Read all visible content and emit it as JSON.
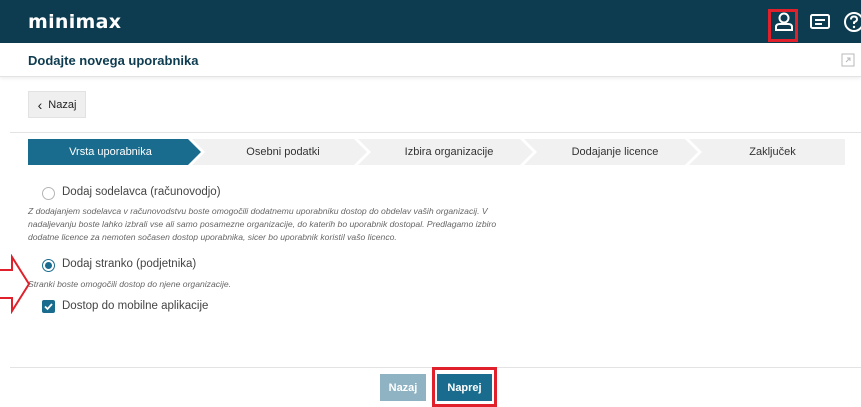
{
  "app": {
    "logo": "minimax"
  },
  "header": {
    "title": "Dodajte novega uporabnika"
  },
  "back_button": {
    "label": "Nazaj",
    "chevron": "‹"
  },
  "steps": [
    {
      "label": "Vrsta uporabnika",
      "active": true
    },
    {
      "label": "Osebni podatki",
      "active": false
    },
    {
      "label": "Izbira organizacije",
      "active": false
    },
    {
      "label": "Dodajanje licence",
      "active": false
    },
    {
      "label": "Zaključek",
      "active": false
    }
  ],
  "options": {
    "accountant": {
      "label": "Dodaj sodelavca (računovodjo)",
      "selected": false,
      "description_lines": [
        "Z dodajanjem sodelavca v računovodstvu boste omogočili dodatnemu uporabniku dostop do obdelav vaših organizacij. V",
        "nadaljevanju boste lahko izbrali vse ali samo posamezne organizacije, do katerih bo uporabnik dostopal. Predlagamo izbiro",
        "dodatne licence za nemoten sočasen dostop uporabnika, sicer bo uporabnik koristil vašo licenco."
      ]
    },
    "client": {
      "label": "Dodaj stranko (podjetnika)",
      "selected": true,
      "description": "Stranki boste omogočili dostop do njene organizacije."
    },
    "mobile": {
      "label": "Dostop do mobilne aplikacije",
      "checked": true
    }
  },
  "footer": {
    "back_label": "Nazaj",
    "next_label": "Naprej"
  },
  "colors": {
    "topbar": "#0d3b4f",
    "accent": "#1a6c8e",
    "step_active": "#1a6c8e",
    "step_inactive": "#f1f1f1",
    "highlight": "#e0202a",
    "back_button": "#8fb3c2"
  }
}
